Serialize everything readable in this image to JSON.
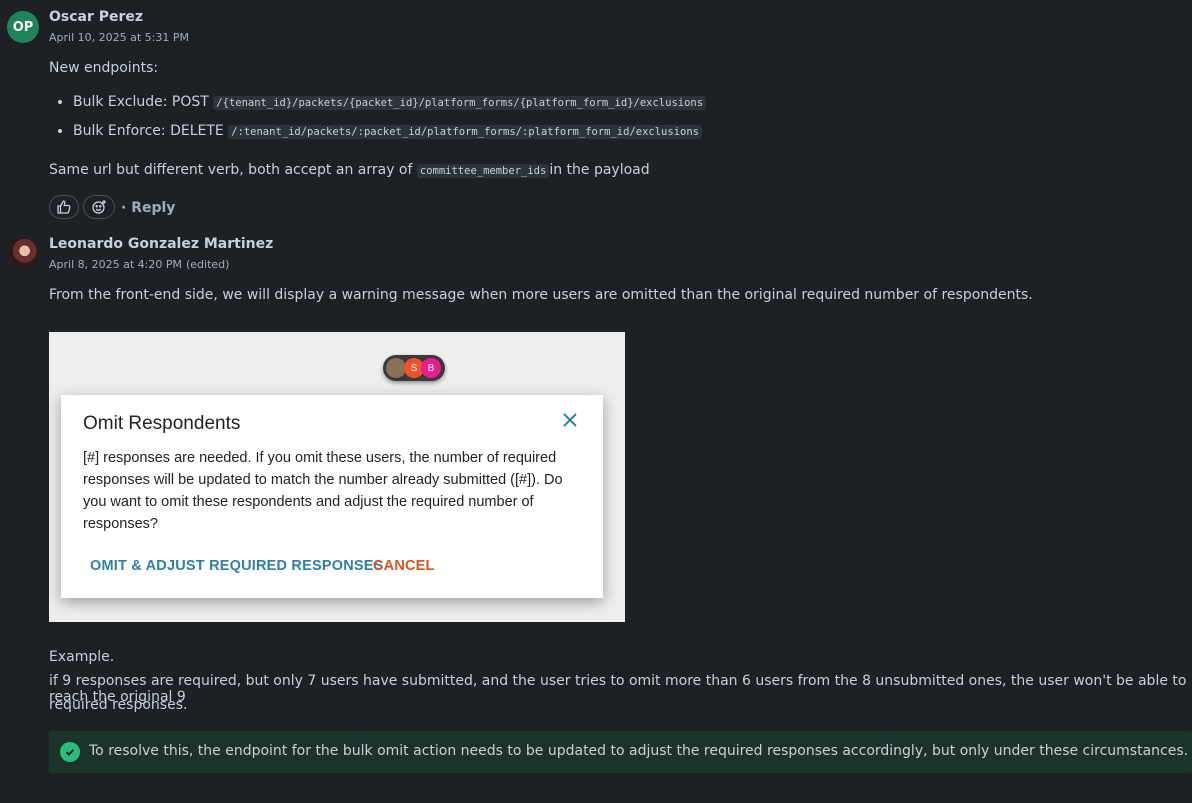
{
  "messages": [
    {
      "initials": "OP",
      "author": "Oscar Perez",
      "timestamp": "April 10, 2025 at 5:31 PM",
      "intro": "New endpoints:",
      "endpoints": [
        {
          "label": "Bulk Exclude: POST",
          "path": "/{tenant_id}/packets/{packet_id}/platform_forms/{platform_form_id}/exclusions"
        },
        {
          "label": "Bulk Enforce: DELETE",
          "path": "/:tenant_id/packets/:packet_id/platform_forms/:platform_form_id/exclusions"
        }
      ],
      "outro_before": "Same url but different verb, both accept an array of",
      "outro_code": "committee_member_ids",
      "outro_after": "in the payload",
      "actions": {
        "reply": "· Reply",
        "like_icon": "thumbs-up-icon",
        "emoji_icon": "add-reaction-icon"
      }
    },
    {
      "author": "Leonardo Gonzalez Martinez",
      "timestamp": "April 8, 2025 at 4:20 PM",
      "edited": "(edited)",
      "intro": "From the front-end side, we will display a warning message when more users are omitted than the original required number of respondents.",
      "screenshot": {
        "chips": [
          "S",
          "B"
        ],
        "chip_colors": [
          "#f0522e",
          "#e91e8c"
        ],
        "dialog_title": "Omit Respondents",
        "dialog_body": "[#] responses are needed. If you omit these users, the number of required responses will be updated to match the number already submitted ([#]). Do you want to omit these respondents and adjust the required number of responses?",
        "primary_button": "OMIT & ADJUST REQUIRED RESPONSES",
        "cancel_button": "CANCEL"
      },
      "example_label": "Example.",
      "example_text_line1": "if 9 responses are required, but only 7 users have submitted, and the user tries to omit more than 6 users from the 8 unsubmitted ones, the user won't be able to reach the original 9",
      "example_text_line2": "required responses.",
      "callout": "To resolve this, the endpoint for the bulk omit action needs to be updated to adjust the required responses accordingly, but only under these circumstances."
    }
  ]
}
